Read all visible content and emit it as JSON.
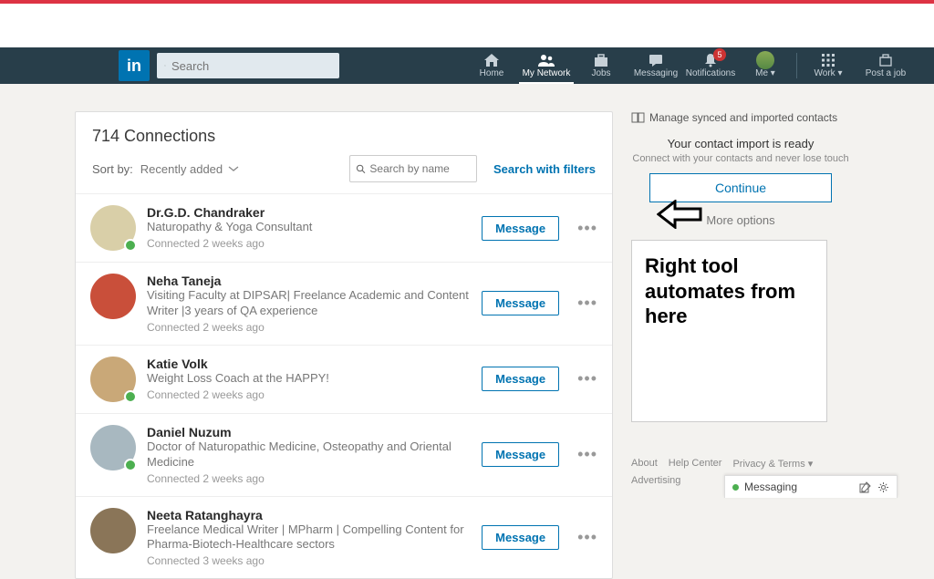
{
  "nav": {
    "search_placeholder": "Search",
    "items": [
      {
        "label": "Home"
      },
      {
        "label": "My Network"
      },
      {
        "label": "Jobs"
      },
      {
        "label": "Messaging"
      },
      {
        "label": "Notifications",
        "badge": "5"
      },
      {
        "label": "Me ▾"
      },
      {
        "label": "Work ▾"
      },
      {
        "label": "Post a job"
      }
    ]
  },
  "main": {
    "title": "714 Connections",
    "sort_label": "Sort by:",
    "sort_value": "Recently added",
    "search_placeholder": "Search by name",
    "filters_link": "Search with filters",
    "msg_label": "Message",
    "connections": [
      {
        "name": "Dr.G.D. Chandraker",
        "sub": "Naturopathy & Yoga Consultant",
        "time": "Connected 2 weeks ago",
        "presence": true,
        "avatar": "#d9cfa8"
      },
      {
        "name": "Neha Taneja",
        "sub": "Visiting Faculty at DIPSAR| Freelance Academic and Content Writer |3 years of QA experience",
        "time": "Connected 2 weeks ago",
        "presence": false,
        "avatar": "#c94f3a"
      },
      {
        "name": "Katie Volk",
        "sub": "Weight Loss Coach at the HAPPY!",
        "time": "Connected 2 weeks ago",
        "presence": true,
        "avatar": "#c9a878"
      },
      {
        "name": "Daniel Nuzum",
        "sub": "Doctor of Naturopathic Medicine, Osteopathy and Oriental Medicine",
        "time": "Connected 2 weeks ago",
        "presence": true,
        "avatar": "#a8b8c0"
      },
      {
        "name": "Neeta Ratanghayra",
        "sub": "Freelance Medical Writer | MPharm | Compelling Content for Pharma-Biotech-Healthcare sectors",
        "time": "Connected 3 weeks ago",
        "presence": false,
        "avatar": "#8a7558"
      }
    ]
  },
  "rhs": {
    "manage": "Manage synced and imported contacts",
    "import_title": "Your contact import is ready",
    "import_sub": "Connect with your contacts and never lose touch",
    "continue": "Continue",
    "more": "More options",
    "annotation": "Right tool automates from here",
    "footer": [
      "About",
      "Help Center",
      "Privacy & Terms ▾"
    ],
    "adv": "Advertising"
  },
  "dock": {
    "label": "Messaging"
  }
}
